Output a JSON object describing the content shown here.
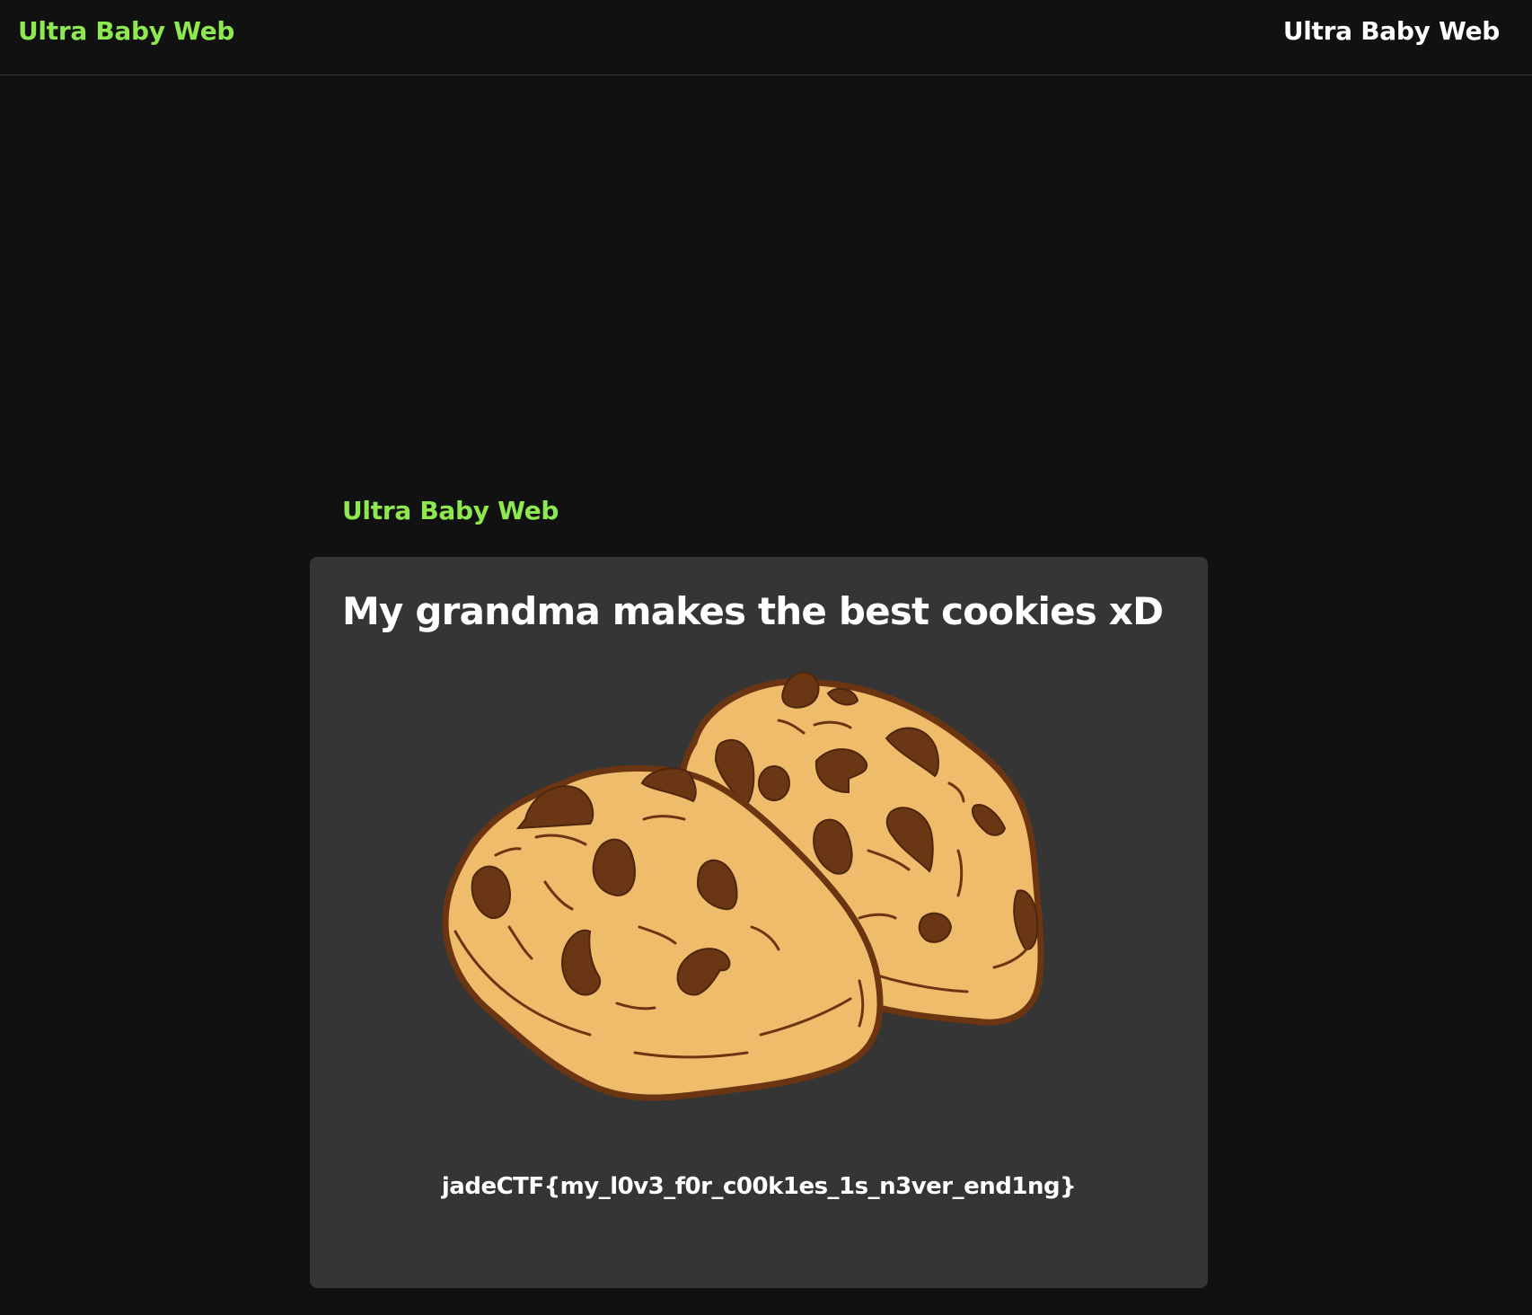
{
  "nav": {
    "brand": "Ultra Baby Web",
    "link": "Ultra Baby Web"
  },
  "section": {
    "heading": "Ultra Baby Web"
  },
  "card": {
    "title": "My grandma makes the best cookies xD",
    "image_icon": "cookies-illustration",
    "flag": "jadeCTF{my_l0v3_f0r_c00k1es_1s_n3ver_end1ng}"
  },
  "colors": {
    "background": "#111111",
    "accent": "#8ee84f",
    "card": "#353535",
    "cookie_dough": "#efbc6c",
    "cookie_outline": "#6b3512",
    "chocolate": "#6a3614"
  }
}
